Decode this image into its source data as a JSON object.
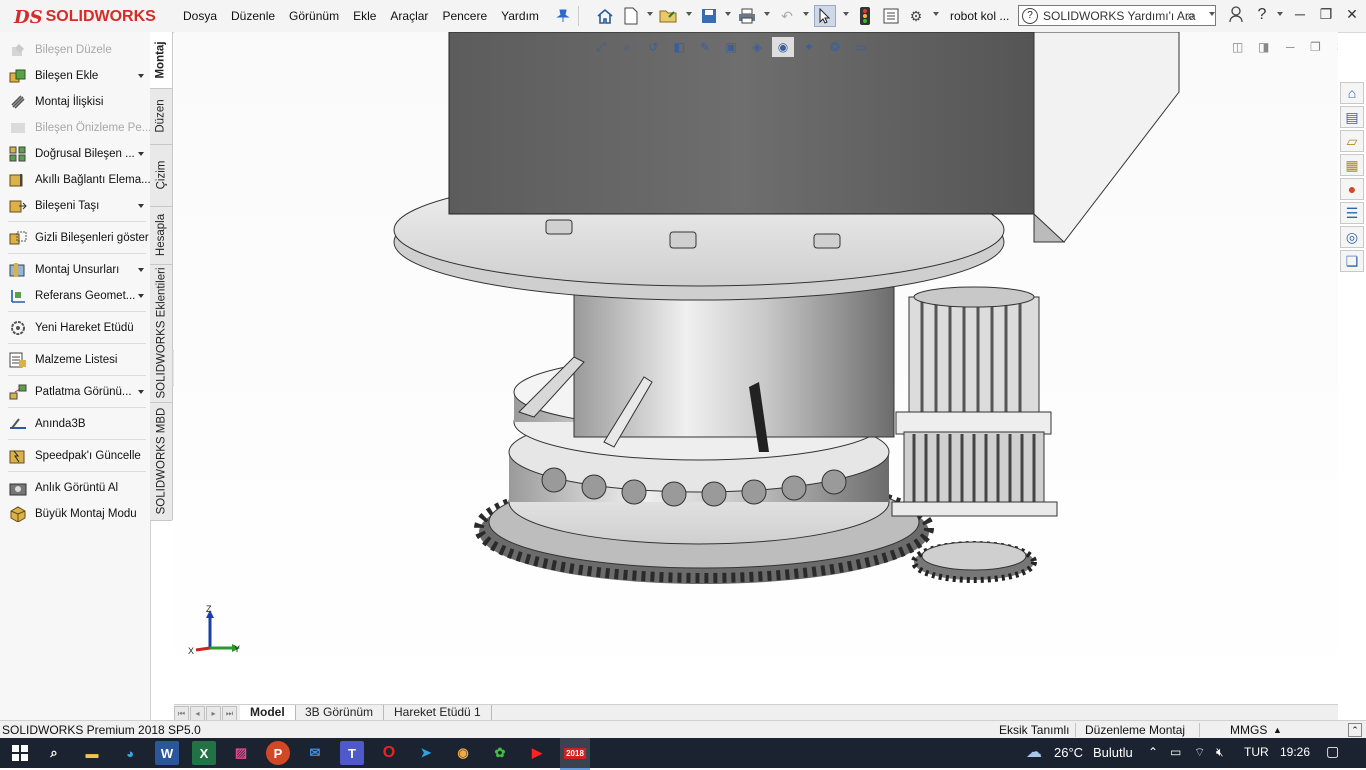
{
  "app": {
    "logo_mark": "DS",
    "logo_text": "SOLIDWORKS",
    "document_name": "robot kol ...",
    "search_placeholder": "SOLIDWORKS Yardımı'ı Ara"
  },
  "menu": [
    "Dosya",
    "Düzenle",
    "Görünüm",
    "Ekle",
    "Araçlar",
    "Pencere",
    "Yardım"
  ],
  "toolbar_icons": [
    "pin-icon",
    "home-icon",
    "new-document-icon",
    "open-icon",
    "save-icon",
    "print-icon",
    "undo-icon",
    "select-pointer-icon",
    "rebuild-traffic-light-icon",
    "file-properties-icon",
    "options-gear-icon"
  ],
  "command_manager": {
    "items": [
      {
        "label": "Bileşen Düzele",
        "disabled": true,
        "icon": "edit-component-icon"
      },
      {
        "label": "Bileşen Ekle",
        "dropdown": true,
        "icon": "insert-component-icon"
      },
      {
        "label": "Montaj İlişkisi",
        "icon": "mate-icon"
      },
      {
        "label": "Bileşen Önizleme Pe...",
        "disabled": true,
        "icon": "component-preview-icon"
      },
      {
        "label": "Doğrusal Bileşen ...",
        "dropdown": true,
        "icon": "linear-pattern-icon"
      },
      {
        "label": "Akıllı Bağlantı Elema...",
        "icon": "smart-fasteners-icon"
      },
      {
        "label": "Bileşeni Taşı",
        "dropdown": true,
        "icon": "move-component-icon"
      },
      {
        "label": "Gizli Bileşenleri göster",
        "icon": "show-hidden-icon"
      },
      {
        "label": "Montaj Unsurları",
        "dropdown": true,
        "icon": "assembly-features-icon"
      },
      {
        "label": "Referans Geomet...",
        "dropdown": true,
        "icon": "reference-geometry-icon"
      },
      {
        "label": "Yeni Hareket Etüdü",
        "icon": "motion-study-icon"
      },
      {
        "label": "Malzeme Listesi",
        "icon": "bill-of-materials-icon"
      },
      {
        "label": "Patlatma Görünü...",
        "dropdown": true,
        "icon": "exploded-view-icon"
      },
      {
        "label": "Anında3B",
        "icon": "instant3d-icon"
      },
      {
        "label": "Speedpak'ı Güncelle",
        "icon": "speedpak-icon"
      },
      {
        "label": "Anlık Görüntü Al",
        "icon": "snapshot-camera-icon"
      },
      {
        "label": "Büyük Montaj Modu",
        "icon": "large-assembly-icon"
      }
    ]
  },
  "side_tabs": [
    "Montaj",
    "Düzen",
    "Çizim",
    "Hesapla",
    "SOLIDWORKS Eklentileri",
    "SOLIDWORKS MBD"
  ],
  "triad": {
    "z": "Z",
    "y": "Y",
    "x": "X"
  },
  "bottom_tabs": [
    "Model",
    "3B Görünüm",
    "Hareket Etüdü 1"
  ],
  "status": {
    "product": "SOLIDWORKS Premium 2018 SP5.0",
    "definition": "Eksik Tanımlı",
    "mode": "Düzenleme Montaj",
    "units": "MMGS"
  },
  "taskbar": {
    "weather_temp": "26°C",
    "weather_text": "Bulutlu",
    "language": "TUR",
    "time": "19:26",
    "solidworks_badge": "2018"
  }
}
